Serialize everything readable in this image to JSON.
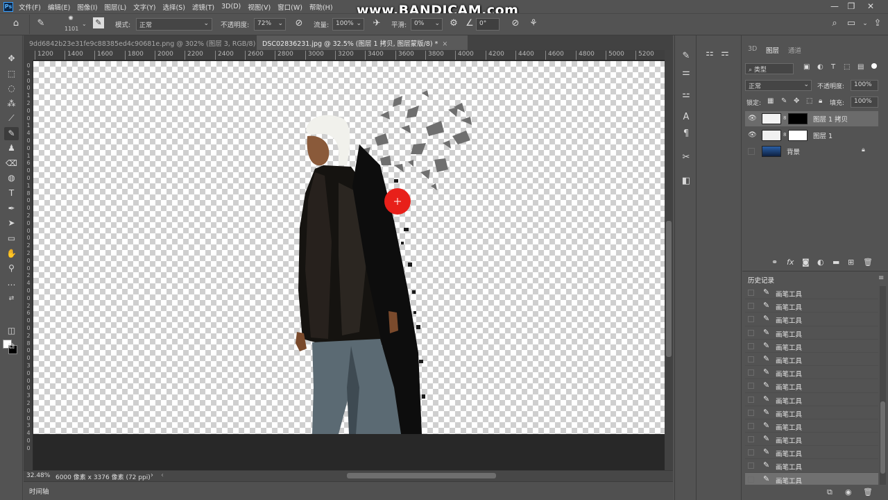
{
  "app": {
    "logo": "Ps",
    "watermark": "www.BANDICAM.com"
  },
  "menu": [
    "文件(F)",
    "编辑(E)",
    "图像(I)",
    "图层(L)",
    "文字(Y)",
    "选择(S)",
    "滤镜(T)",
    "3D(D)",
    "视图(V)",
    "窗口(W)",
    "帮助(H)"
  ],
  "window_controls": {
    "minimize": "—",
    "restore": "❐",
    "close": "✕"
  },
  "options": {
    "brush_size": "1101",
    "mode_label": "模式:",
    "mode_value": "正常",
    "opacity_label": "不透明度:",
    "opacity_value": "72%",
    "flow_label": "流量:",
    "flow_value": "100%",
    "smoothing_label": "平滑:",
    "smoothing_value": "0%",
    "angle_value": "0°"
  },
  "tabs": [
    {
      "label": "9dd6842b23e31fe9c88385ed4c90681e.png @ 302% (图层 3, RGB/8) *",
      "close": "×"
    },
    {
      "label": "DSC02836231.jpg @ 32.5% (图层 1 拷贝, 图层蒙版/8) *",
      "close": "×"
    }
  ],
  "ruler_top": [
    "1200",
    "1400",
    "1600",
    "1800",
    "2000",
    "2200",
    "2400",
    "2600",
    "2800",
    "3000",
    "3200",
    "3400",
    "3600",
    "3800",
    "4000",
    "4200",
    "4400",
    "4600",
    "4800",
    "5000",
    "5200"
  ],
  "ruler_left": [
    "0",
    "1",
    "0",
    "0",
    "1",
    "2",
    "0",
    "0",
    "1",
    "4",
    "0",
    "0",
    "1",
    "6",
    "0",
    "0",
    "1",
    "8",
    "0",
    "0",
    "2",
    "0",
    "0",
    "0",
    "2",
    "2",
    "0",
    "0",
    "2",
    "4",
    "0",
    "0",
    "2",
    "6",
    "0",
    "0",
    "2",
    "8",
    "0",
    "0",
    "3",
    "0",
    "0",
    "0",
    "3",
    "2",
    "0",
    "0",
    "3",
    "4",
    "0",
    "0"
  ],
  "status": {
    "zoom": "32.48%",
    "doc_info": "6000 像素 x 3376 像素 (72 ppi)",
    "arrow": "›",
    "scroll_left": "‹"
  },
  "timeline_label": "时间轴",
  "layers_panel": {
    "tabs": [
      "3D",
      "图层",
      "通道"
    ],
    "filter_label": "类型",
    "blend_mode": "正常",
    "opacity_label": "不透明度:",
    "opacity_value": "100%",
    "lock_label": "锁定:",
    "fill_label": "填充:",
    "fill_value": "100%",
    "layers": [
      {
        "name": "图层 1 拷贝",
        "visible": true,
        "selected": true
      },
      {
        "name": "图层 1",
        "visible": true,
        "selected": false
      },
      {
        "name": "背景",
        "visible": false,
        "selected": false,
        "locked": true
      }
    ]
  },
  "history_panel": {
    "title": "历史记录",
    "items": [
      "画笔工具",
      "画笔工具",
      "画笔工具",
      "画笔工具",
      "画笔工具",
      "画笔工具",
      "画笔工具",
      "画笔工具",
      "画笔工具",
      "画笔工具",
      "画笔工具",
      "画笔工具",
      "画笔工具",
      "画笔工具",
      "画笔工具"
    ]
  },
  "colors": {
    "accent_brush": "#e8201a",
    "panel_bg": "#535353",
    "canvas_bg": "#282828"
  }
}
